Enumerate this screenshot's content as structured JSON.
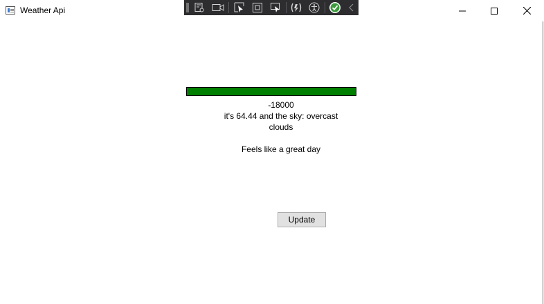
{
  "window": {
    "title": "Weather Api",
    "controls": [
      "minimize-icon",
      "maximize-icon",
      "close-icon"
    ]
  },
  "devtools_toolbar": {
    "tools": [
      "live-visual-tree-icon",
      "video-camera-icon",
      "select-element-icon",
      "display-layout-adorners-icon",
      "track-focus-icon",
      "hot-reload-icon",
      "accessibility-icon",
      "checkmark-icon",
      "collapse-chevron-icon"
    ]
  },
  "main": {
    "progress": {
      "value": 1.0,
      "color": "#008000"
    },
    "value_text": "-18000",
    "weather_line1": "it's 64.44 and the sky: overcast",
    "weather_line2": "clouds",
    "feels_text": "Feels like a great day",
    "update_label": "Update"
  }
}
